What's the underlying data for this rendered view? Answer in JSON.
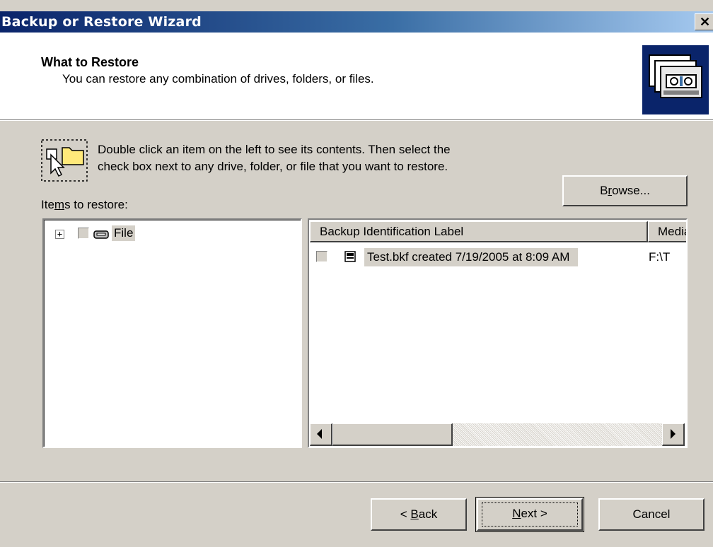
{
  "window": {
    "title": "Backup or Restore Wizard",
    "close_glyph": "✕"
  },
  "header": {
    "title": "What to Restore",
    "subtitle": "You can restore any combination of drives, folders, or files."
  },
  "instructions": {
    "line1": "Double click an item on the left to see its contents. Then select the",
    "line2": "check box next to any drive, folder, or file that you want to restore."
  },
  "items_label": {
    "pre": "Ite",
    "accel": "m",
    "post": "s to restore:"
  },
  "browse_button": {
    "pre": "B",
    "accel": "r",
    "post": "owse..."
  },
  "tree": {
    "items": [
      {
        "label": "File",
        "expander": "+",
        "icon": "drive-icon"
      }
    ]
  },
  "list": {
    "columns": [
      "Backup Identification Label",
      "Media"
    ],
    "rows": [
      {
        "label": "Test.bkf created 7/19/2005 at 8:09 AM",
        "media": "F:\\T",
        "icon": "tape-icon"
      }
    ]
  },
  "buttons": {
    "back": {
      "pre": "< ",
      "accel": "B",
      "post": "ack"
    },
    "next": {
      "pre": "",
      "accel": "N",
      "post": "ext >"
    },
    "cancel": "Cancel"
  },
  "colors": {
    "title_bar_start": "#0a246a",
    "title_bar_end": "#a6caf0",
    "face": "#d4d0c8"
  }
}
